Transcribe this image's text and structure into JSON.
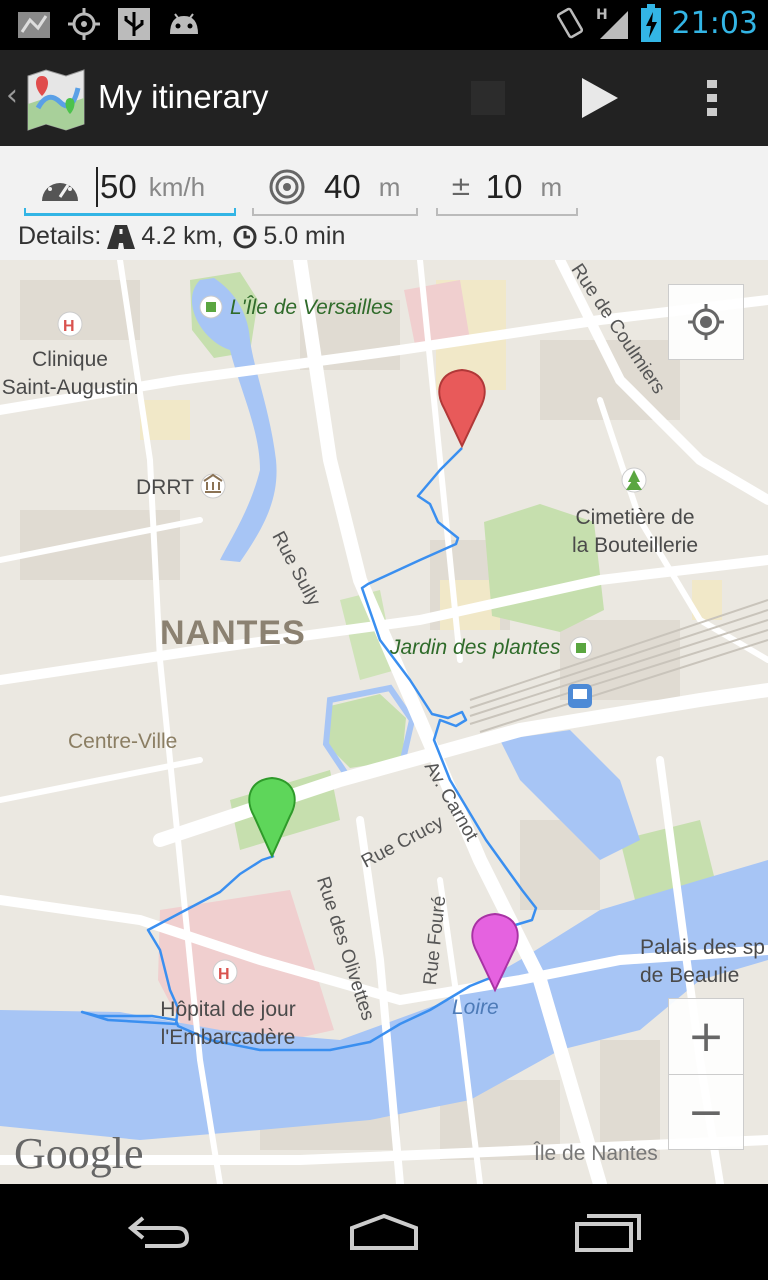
{
  "status_bar": {
    "time": "21:03",
    "network_label": "H",
    "icons": [
      "maps-icon",
      "gps-icon",
      "usb-icon",
      "android-debug-icon",
      "rotation-icon",
      "signal-icon",
      "battery-charging-icon"
    ]
  },
  "action_bar": {
    "title": "My itinerary",
    "icons": [
      "app-icon",
      "stop-icon",
      "play-icon",
      "overflow-menu-icon"
    ]
  },
  "settings": {
    "speed": {
      "value": "50",
      "unit": "km/h"
    },
    "radius": {
      "value": "40",
      "unit": "m"
    },
    "tolerance": {
      "prefix": "±",
      "value": "10",
      "unit": "m"
    }
  },
  "details": {
    "label": "Details:",
    "distance": "4.2 km,",
    "duration": "5.0 min"
  },
  "map": {
    "labels": {
      "ile_versailles": "L'Île de Versailles",
      "clinique": "Clinique\nSaint-Augustin",
      "drrt": "DRRT",
      "rue_sully": "Rue Sully",
      "rue_coulmiers": "Rue de Coulmiers",
      "cimetiere": "Cimetière de\nla Bouteillerie",
      "nantes": "NANTES",
      "jardin": "Jardin des plantes",
      "centre_ville": "Centre-Ville",
      "av_carnot": "Av. Carnot",
      "rue_crucy": "Rue Crucy",
      "rue_olivettes": "Rue des Olivettes",
      "rue_foure": "Rue Fouré",
      "hopital": "Hôpital de jour\nl'Embarcadère",
      "loire": "Loire",
      "palais": "Palais des sp\nde Beaulie",
      "ile_nantes": "Île de Nantes"
    },
    "zoom_in": "+",
    "zoom_out": "−",
    "attribution": "Google",
    "route_color": "#3a8ff0",
    "marker_colors": {
      "start": "#e85a5a",
      "mid": "#5ed65a",
      "end": "#e562e0"
    }
  }
}
